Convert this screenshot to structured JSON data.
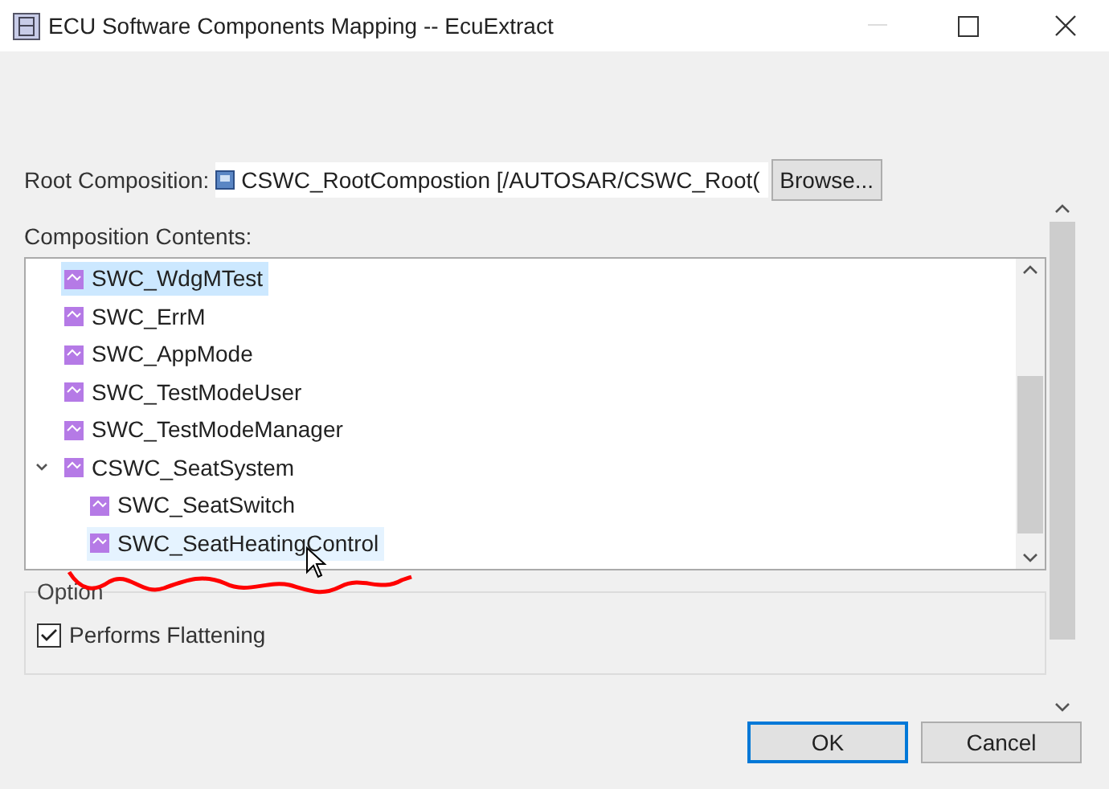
{
  "window": {
    "title": "ECU Software Components Mapping -- EcuExtract"
  },
  "root_composition": {
    "label": "Root Composition:",
    "value": "CSWC_RootCompostion [/AUTOSAR/CSWC_Root(",
    "browse_button": "Browse..."
  },
  "contents_label": "Composition Contents:",
  "tree": [
    {
      "label": "SWC_WdgMTest",
      "selected": true,
      "hovered": false
    },
    {
      "label": "SWC_ErrM",
      "selected": false,
      "hovered": false
    },
    {
      "label": "SWC_AppMode",
      "selected": false,
      "hovered": false
    },
    {
      "label": "SWC_TestModeUser",
      "selected": false,
      "hovered": false
    },
    {
      "label": "SWC_TestModeManager",
      "selected": false,
      "hovered": false
    },
    {
      "label": "CSWC_SeatSystem",
      "selected": false,
      "hovered": false,
      "expanded": true,
      "children": [
        {
          "label": "SWC_SeatSwitch",
          "selected": false,
          "hovered": false
        },
        {
          "label": "SWC_SeatHeatingControl",
          "selected": false,
          "hovered": true
        }
      ]
    }
  ],
  "option": {
    "title": "Option",
    "checkbox": {
      "label": "Performs Flattening",
      "checked": true
    }
  },
  "buttons": [
    {
      "label": "OK",
      "default": true
    },
    {
      "label": "Cancel",
      "default": false
    }
  ]
}
